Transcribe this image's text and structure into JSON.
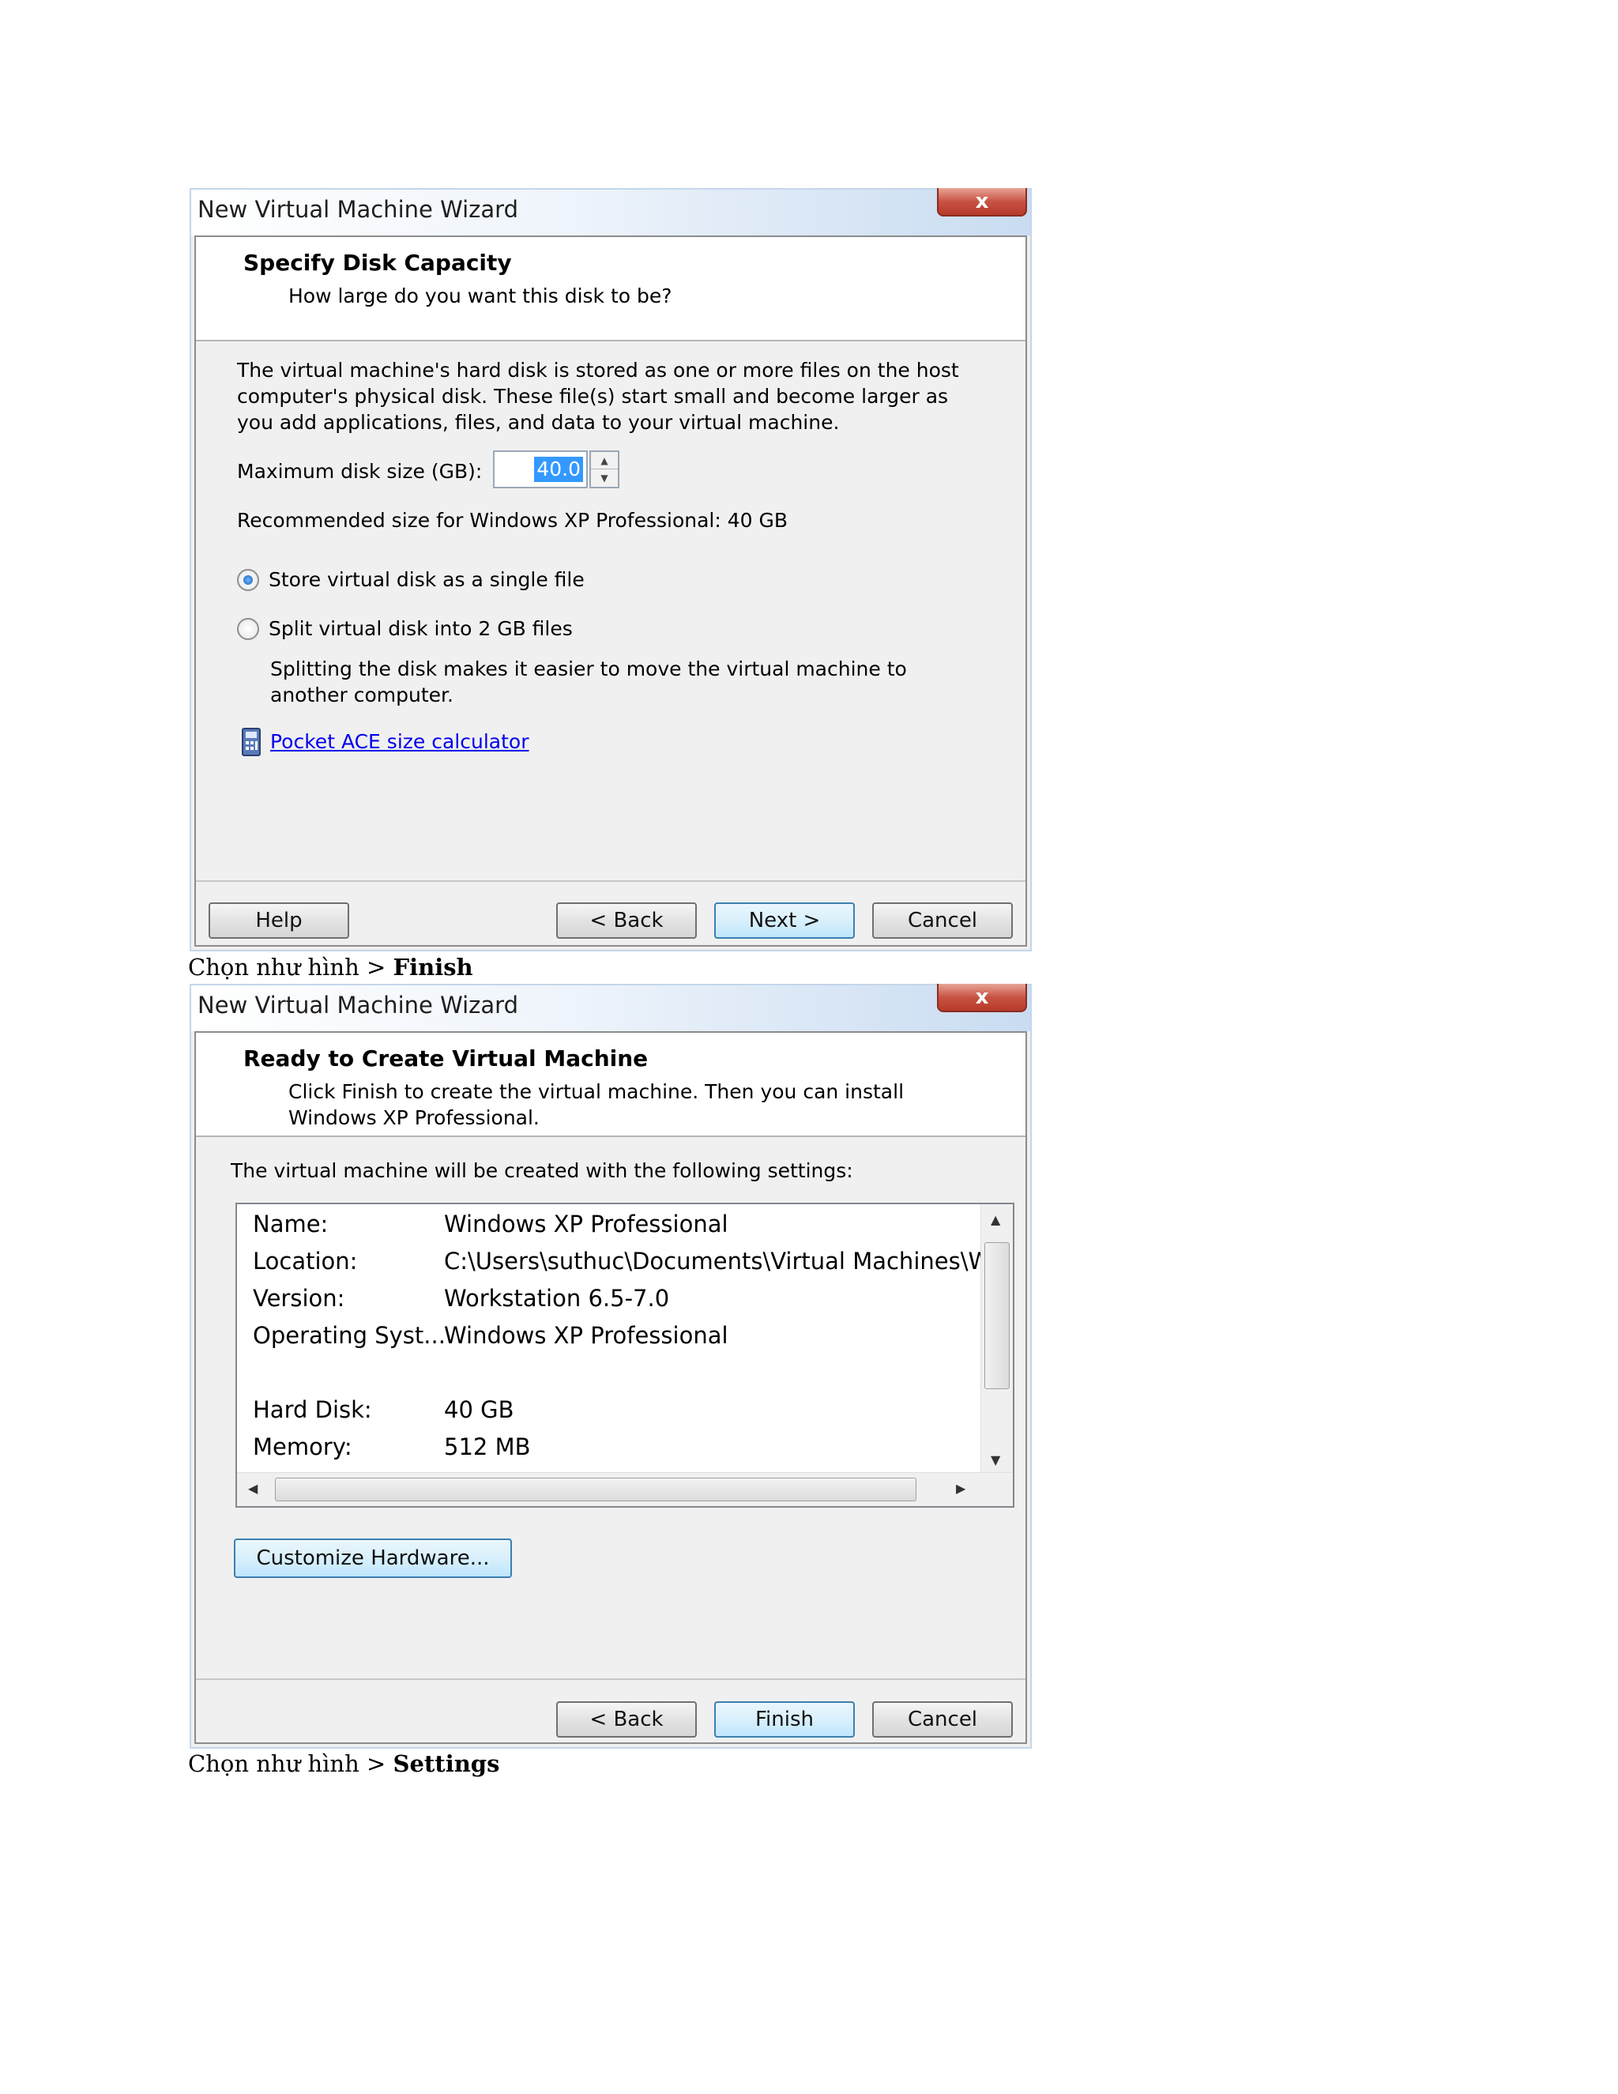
{
  "wizard1": {
    "title": "New Virtual Machine Wizard",
    "close_glyph": "x",
    "header_title": "Specify Disk Capacity",
    "header_subtitle": "How large do you want this disk to be?",
    "description": "The virtual machine's hard disk is stored as one or more files on the host computer's physical disk. These file(s) start small and become larger as you add applications, files, and data to your virtual machine.",
    "max_disk_label": "Maximum disk size (GB):",
    "max_disk_value": "40.0",
    "recommended": "Recommended size for Windows XP Professional: 40 GB",
    "radio_single": "Store virtual disk as a single file",
    "radio_split": "Split virtual disk into 2 GB files",
    "split_note": "Splitting the disk makes it easier to move the virtual machine to another computer.",
    "calculator_link": "Pocket ACE size calculator",
    "buttons": {
      "help": "Help",
      "back": "< Back",
      "next": "Next >",
      "cancel": "Cancel"
    }
  },
  "caption1": {
    "prefix": "Chọn như hình > ",
    "bold": "Finish"
  },
  "wizard2": {
    "title": "New Virtual Machine Wizard",
    "close_glyph": "x",
    "header_title": "Ready to Create Virtual Machine",
    "header_subtitle": "Click Finish to create the virtual machine. Then you can install Windows XP Professional.",
    "intro": "The virtual machine will be created with the following settings:",
    "settings": [
      {
        "key": "Name:",
        "value": "Windows XP Professional"
      },
      {
        "key": "Location:",
        "value": "C:\\Users\\suthuc\\Documents\\Virtual Machines\\Win..."
      },
      {
        "key": "Version:",
        "value": "Workstation 6.5-7.0"
      },
      {
        "key": "Operating Syst...",
        "value": "Windows XP Professional"
      },
      {
        "key": "Hard Disk:",
        "value": "40 GB"
      },
      {
        "key": "Memory:",
        "value": "512 MB"
      }
    ],
    "customize_button": "Customize Hardware...",
    "buttons": {
      "back": "< Back",
      "finish": "Finish",
      "cancel": "Cancel"
    }
  },
  "caption2": {
    "prefix": "Chọn như hình  > ",
    "bold": "Settings"
  }
}
